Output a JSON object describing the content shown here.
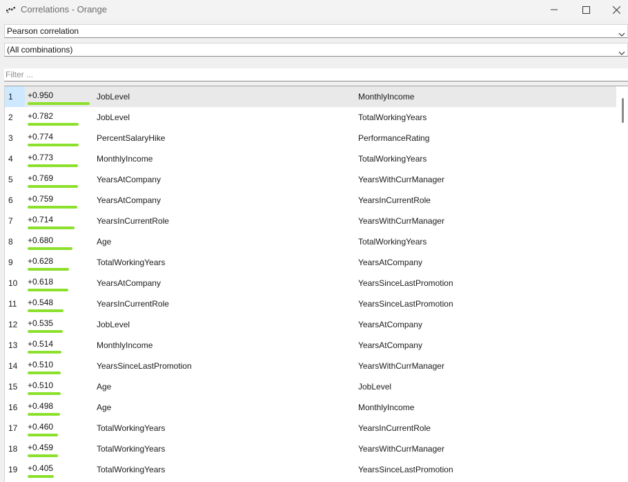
{
  "window": {
    "title": "Correlations - Orange",
    "icons": {
      "app": "orange-logo-icon",
      "minimize": "minimize-icon",
      "maximize": "maximize-icon",
      "close": "close-icon"
    }
  },
  "controls": {
    "method": "Pearson correlation",
    "feature": "(All combinations)",
    "filter_placeholder": "Filter ..."
  },
  "colors": {
    "bar": "#8be02b",
    "selected_index": "#cde8ff",
    "selected_row": "#e9e9e9"
  },
  "table": {
    "selected_row": 1,
    "rows": [
      {
        "index": "1",
        "value": "+0.950",
        "magnitude": 0.95,
        "feature1": "JobLevel",
        "feature2": "MonthlyIncome"
      },
      {
        "index": "2",
        "value": "+0.782",
        "magnitude": 0.782,
        "feature1": "JobLevel",
        "feature2": "TotalWorkingYears"
      },
      {
        "index": "3",
        "value": "+0.774",
        "magnitude": 0.774,
        "feature1": "PercentSalaryHike",
        "feature2": "PerformanceRating"
      },
      {
        "index": "4",
        "value": "+0.773",
        "magnitude": 0.773,
        "feature1": "MonthlyIncome",
        "feature2": "TotalWorkingYears"
      },
      {
        "index": "5",
        "value": "+0.769",
        "magnitude": 0.769,
        "feature1": "YearsAtCompany",
        "feature2": "YearsWithCurrManager"
      },
      {
        "index": "6",
        "value": "+0.759",
        "magnitude": 0.759,
        "feature1": "YearsAtCompany",
        "feature2": "YearsInCurrentRole"
      },
      {
        "index": "7",
        "value": "+0.714",
        "magnitude": 0.714,
        "feature1": "YearsInCurrentRole",
        "feature2": "YearsWithCurrManager"
      },
      {
        "index": "8",
        "value": "+0.680",
        "magnitude": 0.68,
        "feature1": "Age",
        "feature2": "TotalWorkingYears"
      },
      {
        "index": "9",
        "value": "+0.628",
        "magnitude": 0.628,
        "feature1": "TotalWorkingYears",
        "feature2": "YearsAtCompany"
      },
      {
        "index": "10",
        "value": "+0.618",
        "magnitude": 0.618,
        "feature1": "YearsAtCompany",
        "feature2": "YearsSinceLastPromotion"
      },
      {
        "index": "11",
        "value": "+0.548",
        "magnitude": 0.548,
        "feature1": "YearsInCurrentRole",
        "feature2": "YearsSinceLastPromotion"
      },
      {
        "index": "12",
        "value": "+0.535",
        "magnitude": 0.535,
        "feature1": "JobLevel",
        "feature2": "YearsAtCompany"
      },
      {
        "index": "13",
        "value": "+0.514",
        "magnitude": 0.514,
        "feature1": "MonthlyIncome",
        "feature2": "YearsAtCompany"
      },
      {
        "index": "14",
        "value": "+0.510",
        "magnitude": 0.51,
        "feature1": "YearsSinceLastPromotion",
        "feature2": "YearsWithCurrManager"
      },
      {
        "index": "15",
        "value": "+0.510",
        "magnitude": 0.51,
        "feature1": "Age",
        "feature2": "JobLevel"
      },
      {
        "index": "16",
        "value": "+0.498",
        "magnitude": 0.498,
        "feature1": "Age",
        "feature2": "MonthlyIncome"
      },
      {
        "index": "17",
        "value": "+0.460",
        "magnitude": 0.46,
        "feature1": "TotalWorkingYears",
        "feature2": "YearsInCurrentRole"
      },
      {
        "index": "18",
        "value": "+0.459",
        "magnitude": 0.459,
        "feature1": "TotalWorkingYears",
        "feature2": "YearsWithCurrManager"
      },
      {
        "index": "19",
        "value": "+0.405",
        "magnitude": 0.405,
        "feature1": "TotalWorkingYears",
        "feature2": "YearsSinceLastPromotion"
      }
    ]
  }
}
